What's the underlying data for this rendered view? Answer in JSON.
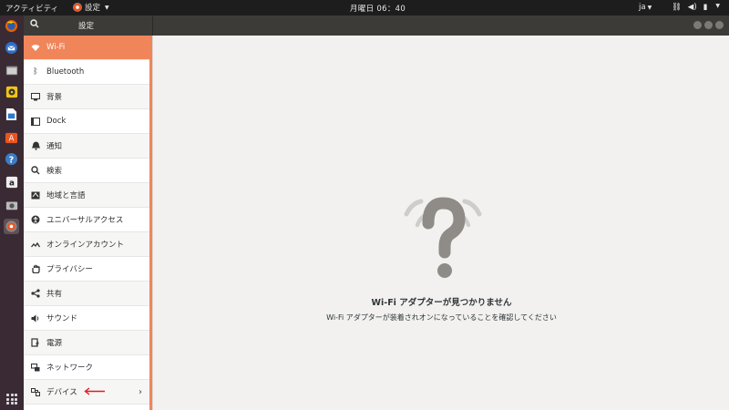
{
  "topbar": {
    "activities": "アクティビティ",
    "app_menu": "設定",
    "clock": "月曜日 06：40",
    "lang": "ja"
  },
  "dock": {
    "items": [
      {
        "icon": "firefox-icon"
      },
      {
        "icon": "thunderbird-icon"
      },
      {
        "icon": "files-icon"
      },
      {
        "icon": "rhythmbox-icon"
      },
      {
        "icon": "libreoffice-writer-icon"
      },
      {
        "icon": "software-center-icon"
      },
      {
        "icon": "help-icon"
      },
      {
        "icon": "amazon-icon"
      },
      {
        "icon": "screenshot-icon"
      },
      {
        "icon": "settings-icon"
      }
    ]
  },
  "window": {
    "title": "設定"
  },
  "sidebar": {
    "items": [
      {
        "label": "Wi-Fi",
        "icon": "wifi-icon"
      },
      {
        "label": "Bluetooth",
        "icon": "bluetooth-icon"
      },
      {
        "label": "背景",
        "icon": "background-icon"
      },
      {
        "label": "Dock",
        "icon": "dock-icon"
      },
      {
        "label": "通知",
        "icon": "bell-icon"
      },
      {
        "label": "検索",
        "icon": "search-icon"
      },
      {
        "label": "地域と言語",
        "icon": "flag-icon"
      },
      {
        "label": "ユニバーサルアクセス",
        "icon": "accessibility-icon"
      },
      {
        "label": "オンラインアカウント",
        "icon": "online-accounts-icon"
      },
      {
        "label": "プライバシー",
        "icon": "hand-icon"
      },
      {
        "label": "共有",
        "icon": "share-icon"
      },
      {
        "label": "サウンド",
        "icon": "speaker-icon"
      },
      {
        "label": "電源",
        "icon": "power-icon"
      },
      {
        "label": "ネットワーク",
        "icon": "network-icon"
      },
      {
        "label": "デバイス",
        "icon": "devices-icon"
      }
    ]
  },
  "main": {
    "empty_title": "Wi-Fi アダプターが見つかりません",
    "empty_subtitle": "Wi-Fi アダプターが装着されオンになっていることを確認してください"
  },
  "colors": {
    "accent": "#f0855a",
    "topbar": "#1d1d1d",
    "dock": "#3a2a33",
    "annotation_arrow": "#e01b24"
  }
}
